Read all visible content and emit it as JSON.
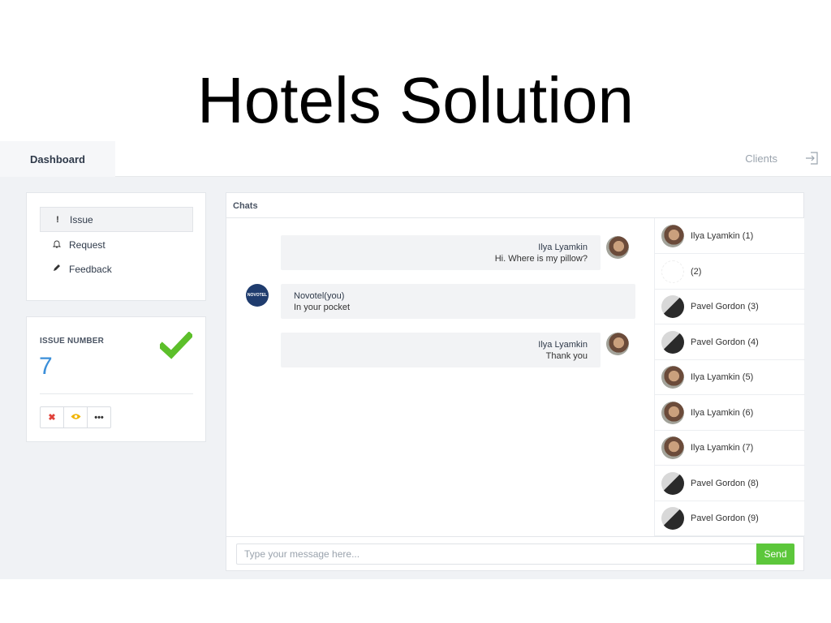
{
  "slide": {
    "title": "Hotels Solution"
  },
  "navbar": {
    "dashboard_label": "Dashboard",
    "clients_label": "Clients",
    "logout_icon": "logout-icon"
  },
  "menu": {
    "items": [
      {
        "label": "Issue",
        "icon": "exclamation-icon",
        "active": true
      },
      {
        "label": "Request",
        "icon": "bell-icon",
        "active": false
      },
      {
        "label": "Feedback",
        "icon": "pencil-icon",
        "active": false
      }
    ]
  },
  "issue": {
    "label": "ISSUE NUMBER",
    "number": "7",
    "status_icon": "checkmark-icon",
    "actions": [
      {
        "icon": "close-icon",
        "glyph": "✖",
        "color": "#e0413a"
      },
      {
        "icon": "eye-icon",
        "glyph": "👁",
        "color": "#f0b400"
      },
      {
        "icon": "more-icon",
        "glyph": "•••",
        "color": "#333333"
      }
    ]
  },
  "chat": {
    "header": "Chats",
    "messages": [
      {
        "name": "Ilya Lyamkin",
        "text": "Hi. Where is my pillow?",
        "side": "right"
      },
      {
        "name": "Novotel(you)",
        "text": "In your pocket",
        "side": "left"
      },
      {
        "name": "Ilya Lyamkin",
        "text": "Thank you",
        "side": "right"
      }
    ],
    "novotel_logo_text": "NOVOTEL",
    "clients": [
      "Ilya Lyamkin (1)",
      "(2)",
      "Pavel Gordon (3)",
      "Pavel Gordon (4)",
      "Ilya Lyamkin (5)",
      "Ilya Lyamkin (6)",
      "Ilya Lyamkin (7)",
      "Pavel Gordon (8)",
      "Pavel Gordon (9)"
    ],
    "input_placeholder": "Type your message here...",
    "send_label": "Send"
  },
  "colors": {
    "accent_blue": "#3b8fd9",
    "success_green": "#5cc73b",
    "check_green": "#5cbf2a",
    "danger_red": "#e0413a",
    "warning_yellow": "#f0b400"
  }
}
